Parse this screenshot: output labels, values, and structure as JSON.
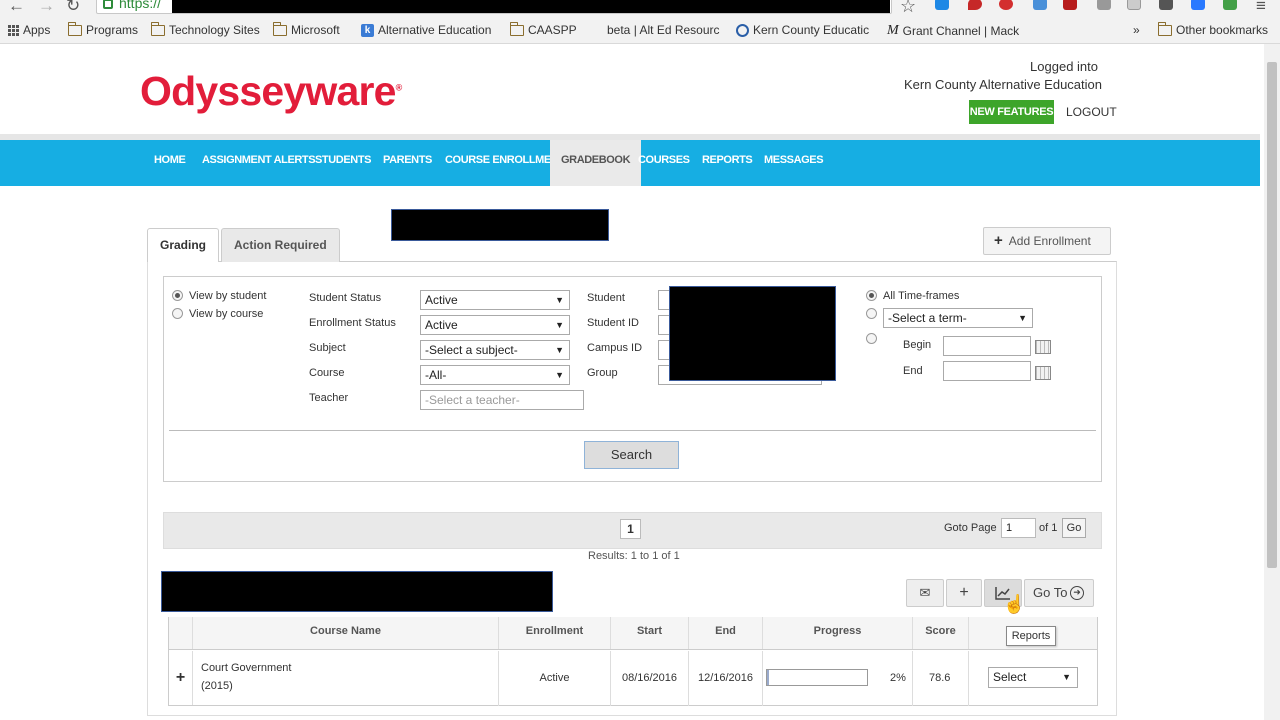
{
  "browser": {
    "url_prefix": "https://",
    "bookmarks": [
      "Apps",
      "Programs",
      "Technology Sites",
      "Microsoft",
      "Alternative Education",
      "CAASPP",
      "beta | Alt Ed Resourc",
      "Kern County Educatic",
      "Grant Channel | Mack",
      "»",
      "Other bookmarks"
    ]
  },
  "header": {
    "logo": "Odysseyware",
    "logo_mark": "®",
    "login_line1": "Logged into",
    "login_line2": "Kern County Alternative Education",
    "new_features": "NEW FEATURES",
    "logout": "LOGOUT"
  },
  "nav": {
    "items": [
      "HOME",
      "ASSIGNMENT ALERTS",
      "STUDENTS",
      "PARENTS",
      "COURSE ENROLLMENT",
      "GRADEBOOK",
      "COURSES",
      "REPORTS",
      "MESSAGES"
    ],
    "active": "GRADEBOOK",
    "bg_color": "#16aee3"
  },
  "tabs": [
    "Grading",
    "Action Required"
  ],
  "add_enrollment": "Add Enrollment",
  "filters": {
    "view_by_student": "View by student",
    "view_by_course": "View by course",
    "student_status_label": "Student Status",
    "student_status": "Active",
    "enrollment_status_label": "Enrollment Status",
    "enrollment_status": "Active",
    "subject_label": "Subject",
    "subject": "-Select a subject-",
    "course_label": "Course",
    "course": "-All-",
    "teacher_label": "Teacher",
    "teacher_placeholder": "-Select a teacher-",
    "student_label": "Student",
    "student_id_label": "Student ID",
    "campus_id_label": "Campus ID",
    "group_label": "Group",
    "all_timeframes": "All Time-frames",
    "term": "-Select a term-",
    "begin_label": "Begin",
    "end_label": "End",
    "search": "Search"
  },
  "pager": {
    "page": "1",
    "goto_label": "Goto Page",
    "goto_value": "1",
    "of_label": "of 1",
    "go": "Go",
    "results": "Results: 1 to 1 of 1"
  },
  "toolbar": {
    "goto": "Go To",
    "tooltip": "Reports"
  },
  "table": {
    "headers": [
      "Course Name",
      "Enrollment",
      "Start",
      "End",
      "Progress",
      "Score"
    ],
    "rows": [
      {
        "expand": "+",
        "course_line1": "Court Government",
        "course_line2": "(2015)",
        "enrollment": "Active",
        "start": "08/16/2016",
        "end": "12/16/2016",
        "progress": "2%",
        "progress_value": 2,
        "score": "78.6",
        "action": "Select"
      }
    ]
  },
  "colors": {
    "logo_red": "#e21d3a",
    "feature_green": "#3da52a"
  }
}
